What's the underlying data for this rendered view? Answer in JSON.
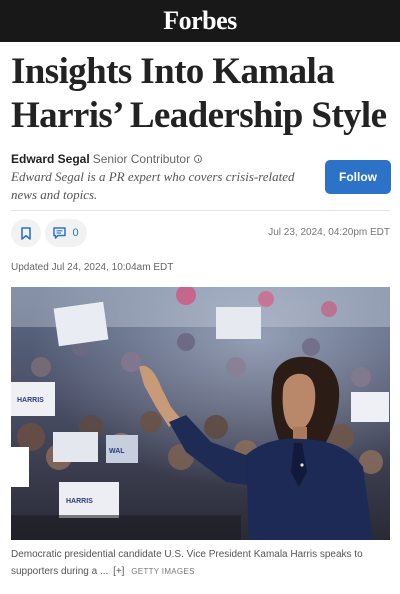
{
  "header": {
    "logo": "Forbes"
  },
  "article": {
    "headline": "Insights Into Kamala Harris’ Leadership Style",
    "author": "Edward Segal",
    "author_role": "Senior Contributor",
    "bio": "Edward Segal is a PR expert who covers crisis-related news and topics.",
    "follow_label": "Follow",
    "comment_count": "0",
    "published": "Jul 23, 2024, 04:20pm EDT",
    "updated": "Updated Jul 24, 2024, 10:04am EDT"
  },
  "image": {
    "caption": "Democratic presidential candidate U.S. Vice President Kamala Harris speaks to supporters during a ...",
    "expand": "[+]",
    "credit": "GETTY IMAGES"
  },
  "colors": {
    "accent": "#2c72c7",
    "topbar": "#181818"
  }
}
